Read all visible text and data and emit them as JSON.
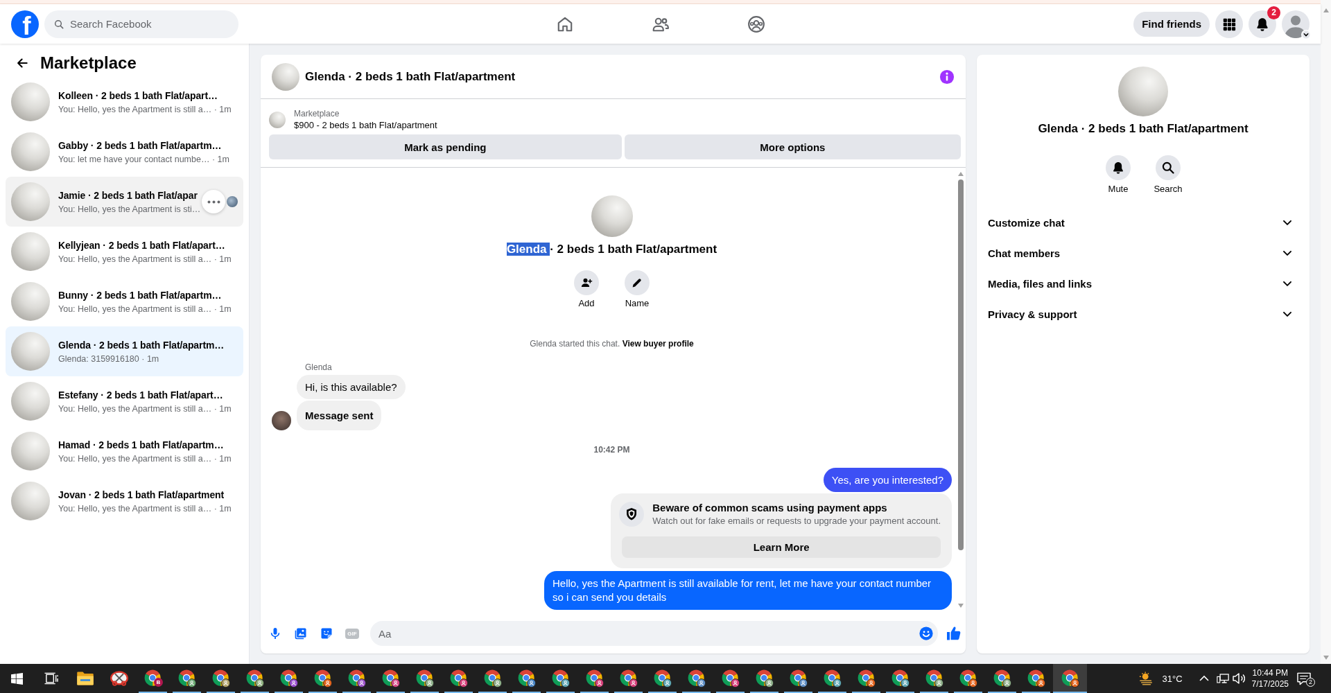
{
  "header": {
    "logo": "f",
    "search": {
      "placeholder": "Search Facebook"
    },
    "find_friends": "Find friends",
    "notification_count": "2"
  },
  "sidebar": {
    "title": "Marketplace",
    "conversations": [
      {
        "title": "Kolleen · 2 beds 1 bath Flat/apart…",
        "snippet": "You: Hello, yes the Apartment is still a… · 1m",
        "selected": false,
        "hovered": false,
        "seen": false
      },
      {
        "title": "Gabby · 2 beds 1 bath Flat/apartm…",
        "snippet": "You: let me have your contact numbe… · 1m",
        "selected": false,
        "hovered": false,
        "seen": false
      },
      {
        "title": "Jamie · 2 beds 1 bath Flat/apar",
        "snippet": "You: Hello, yes the Apartment is sti…",
        "selected": false,
        "hovered": true,
        "seen": true
      },
      {
        "title": "Kellyjean · 2 beds 1 bath Flat/apart…",
        "snippet": "You: Hello, yes the Apartment is still a… · 1m",
        "selected": false,
        "hovered": false,
        "seen": false
      },
      {
        "title": "Bunny · 2 beds 1 bath Flat/apartm…",
        "snippet": "You: Hello, yes the Apartment is still a… · 1m",
        "selected": false,
        "hovered": false,
        "seen": false
      },
      {
        "title": "Glenda · 2 beds 1 bath Flat/apartm…",
        "snippet": "Glenda: 3159916180 · 1m",
        "selected": true,
        "hovered": false,
        "seen": false
      },
      {
        "title": "Estefany · 2 beds 1 bath Flat/apart…",
        "snippet": "You: Hello, yes the Apartment is still a… · 1m",
        "selected": false,
        "hovered": false,
        "seen": false
      },
      {
        "title": "Hamad · 2 beds 1 bath Flat/apartm…",
        "snippet": "You: Hello, yes the Apartment is still a… · 1m",
        "selected": false,
        "hovered": false,
        "seen": false
      },
      {
        "title": "Jovan · 2 beds 1 bath Flat/apartment",
        "snippet": "You: Hello, yes the Apartment is still a… · 1m",
        "selected": false,
        "hovered": false,
        "seen": false
      }
    ]
  },
  "chat": {
    "title": "Glenda · 2 beds 1 bath Flat/apartment",
    "listing": {
      "source": "Marketplace",
      "summary": "$900 - 2 beds 1 bath Flat/apartment"
    },
    "actions": [
      "Mark as pending",
      "More options"
    ],
    "intro": {
      "title_parts": [
        {
          "text": "Glenda ",
          "selected": true
        },
        {
          "text": "· 2 beds 1 bath Flat/apartment",
          "selected": false
        }
      ],
      "buttons": [
        {
          "kind": "add",
          "label": "Add"
        },
        {
          "kind": "name",
          "label": "Name"
        }
      ]
    },
    "messages": [
      {
        "kind": "event",
        "text": "Glenda started this chat. ",
        "link": "View buyer profile"
      },
      {
        "kind": "sender",
        "text": "Glenda"
      },
      {
        "kind": "incoming",
        "text": "Hi, is this available?",
        "bold": false,
        "avatar": false
      },
      {
        "kind": "incoming",
        "text": "Message sent",
        "bold": true,
        "avatar": true
      },
      {
        "kind": "time",
        "text": "10:42 PM"
      },
      {
        "kind": "outgoing",
        "text": "Yes, are you interested?",
        "color": "#3d50f5"
      },
      {
        "kind": "notice",
        "title": "Beware of common scams using payment apps",
        "text": "Watch out for fake emails or requests to upgrade your payment account.",
        "button": "Learn More"
      },
      {
        "kind": "outgoing",
        "text": "Hello, yes the Apartment is still available for rent, let me have your contact number so i can send you details",
        "color": "#0866ff"
      }
    ],
    "composer": {
      "tools": [
        {
          "kind": "mic"
        },
        {
          "kind": "photo"
        },
        {
          "kind": "sticker"
        },
        {
          "kind": "gif",
          "label": "GIF"
        }
      ],
      "placeholder": "Aa"
    }
  },
  "details": {
    "title": "Glenda · 2 beds 1 bath Flat/apartment",
    "actions": [
      {
        "kind": "mute",
        "label": "Mute"
      },
      {
        "kind": "search",
        "label": "Search"
      }
    ],
    "sections": [
      {
        "label": "Customize chat",
        "expanded": false
      },
      {
        "label": "Chat members",
        "expanded": false
      },
      {
        "label": "Media, files and links",
        "expanded": false
      },
      {
        "label": "Privacy & support",
        "expanded": false
      }
    ]
  },
  "taskbar": {
    "apps": [
      {
        "kind": "start"
      },
      {
        "kind": "task-view"
      },
      {
        "kind": "files"
      },
      {
        "kind": "snipping"
      },
      {
        "kind": "browser",
        "color": "#b0174f",
        "badge": "B",
        "active": false
      },
      {
        "kind": "browser",
        "color": "#6aa872",
        "active": false
      },
      {
        "kind": "browser",
        "color": "#b3a36b",
        "active": false
      },
      {
        "kind": "browser",
        "color": "#8fb07f",
        "active": false
      },
      {
        "kind": "browser",
        "color": "#9b4fd0",
        "active": false
      },
      {
        "kind": "browser",
        "color": "#e5651e",
        "active": false
      },
      {
        "kind": "browser",
        "color": "#9d55c9",
        "active": false
      },
      {
        "kind": "browser",
        "color": "#d84a86",
        "active": false
      },
      {
        "kind": "browser",
        "color": "#8fb08a",
        "active": false
      },
      {
        "kind": "browser",
        "color": "#d8407a",
        "active": false
      },
      {
        "kind": "browser",
        "color": "#8fb08a",
        "active": false
      },
      {
        "kind": "browser",
        "color": "#4a86c5",
        "active": false
      },
      {
        "kind": "browser",
        "color": "#5fa8b5",
        "active": false
      },
      {
        "kind": "browser",
        "color": "#d8407a",
        "active": false
      },
      {
        "kind": "browser",
        "color": "#d8407a",
        "active": false
      },
      {
        "kind": "browser",
        "color": "#5fa8b5",
        "active": false
      },
      {
        "kind": "browser",
        "color": "#5f8fc5",
        "active": false
      },
      {
        "kind": "browser",
        "color": "#d8407a",
        "active": false
      },
      {
        "kind": "browser",
        "color": "#8fb08a",
        "active": false
      },
      {
        "kind": "browser",
        "color": "#5f8fc5",
        "active": false
      },
      {
        "kind": "browser",
        "color": "#5fa8b5",
        "active": false
      },
      {
        "kind": "browser",
        "color": "#e5651e",
        "active": false
      },
      {
        "kind": "browser",
        "color": "#5fa8b5",
        "active": false
      },
      {
        "kind": "browser",
        "color": "#8fb08a",
        "active": false
      },
      {
        "kind": "browser",
        "color": "#e5651e",
        "active": false
      },
      {
        "kind": "browser",
        "color": "#8fb08a",
        "active": false
      },
      {
        "kind": "browser",
        "color": "#e5651e",
        "active": false
      },
      {
        "kind": "browser",
        "color": "#e5651e",
        "active": true
      }
    ],
    "weather": "31°C",
    "time": "10:44 PM",
    "date": "7/17/2025",
    "notification_count": "2"
  }
}
